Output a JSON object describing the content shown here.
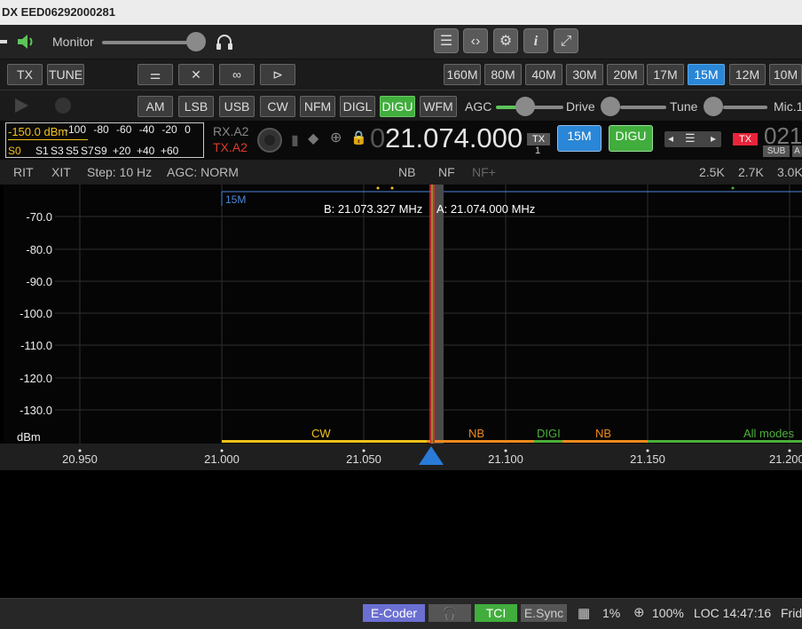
{
  "title": "DX EED06292000281",
  "monitor": {
    "label": "Monitor",
    "volume_level": 0.85
  },
  "toolbar_icons": [
    "list-icon",
    "code-icon",
    "gear-icon",
    "info-icon",
    "expand-icon"
  ],
  "tx_buttons": {
    "tx": "TX",
    "tune": "TUNE"
  },
  "bands": [
    "160M",
    "80M",
    "40M",
    "30M",
    "20M",
    "17M",
    "15M",
    "12M",
    "10M"
  ],
  "active_band": "15M",
  "modes": [
    "AM",
    "LSB",
    "USB",
    "CW",
    "NFM",
    "DIGL",
    "DIGU",
    "WFM"
  ],
  "active_mode": "DIGU",
  "sliders": {
    "agc": "AGC",
    "drive": "Drive",
    "tune": "Tune",
    "mic": "Mic.1"
  },
  "smeter": {
    "reading": "-150.0 dBm",
    "dbm_scale": "-100 -80 -60 -40 -20 0",
    "s_scale": [
      "S0",
      "S1",
      "S3",
      "S5",
      "S7",
      "S9",
      "+20",
      "+40",
      "+60"
    ]
  },
  "antenna": {
    "rx": "RX.A2",
    "tx": "TX.A2"
  },
  "vfo_a": {
    "frequency_lead": "0",
    "frequency": "21.074.000",
    "tx_badge": "TX",
    "tx_num": "1",
    "band": "15M",
    "mode": "DIGU"
  },
  "vfo_b": {
    "tx_label": "TX",
    "frequency": "021",
    "sub": "SUB",
    "a": "A"
  },
  "rit_bar": {
    "rit": "RIT",
    "xit": "XIT",
    "step": "Step: 10 Hz",
    "agc": "AGC: NORM",
    "nb": "NB",
    "nf": "NF",
    "nfplus": "NF+",
    "filters": [
      "2.5K",
      "2.7K",
      "3.0K"
    ]
  },
  "spectrum": {
    "band_label": "15M",
    "vfo_b_label": "B: 21.073.327 MHz",
    "vfo_a_label": "A: 21.074.000 MHz",
    "db_ticks": [
      "-70.0",
      "-80.0",
      "-90.0",
      "-100.0",
      "-110.0",
      "-120.0",
      "-130.0"
    ],
    "db_unit": "dBm",
    "freq_ticks": [
      "20.950",
      "21.000",
      "21.050",
      "21.100",
      "21.150",
      "21.200"
    ],
    "segments": {
      "cw": "CW",
      "nb1": "NB",
      "digi": "DIGI",
      "nb2": "NB",
      "all": "All modes"
    },
    "colors": {
      "cw": "#f2c21a",
      "nb": "#f08a1c",
      "digi": "#4caf3b",
      "all": "#4caf3b",
      "vfo_marker": "#2a7bd8"
    }
  },
  "status": {
    "ecoder": "E-Coder",
    "tci": "TCI",
    "esync": "E.Sync",
    "cpu": "1%",
    "zoom": "100%",
    "loc": "LOC 14:47:16",
    "day": "Frid"
  }
}
